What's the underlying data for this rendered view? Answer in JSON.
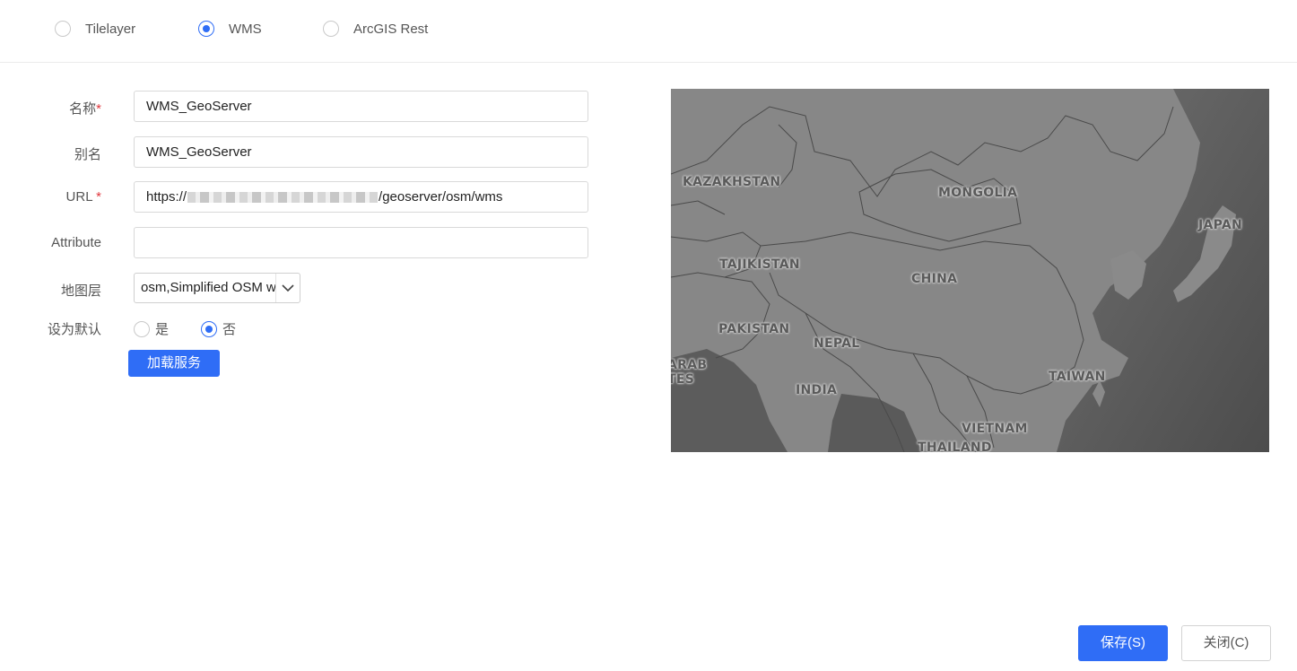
{
  "source_tabs": [
    {
      "label": "Tilelayer",
      "selected": false
    },
    {
      "label": "WMS",
      "selected": true
    },
    {
      "label": "ArcGIS Rest",
      "selected": false
    }
  ],
  "form": {
    "name": {
      "label": "名称",
      "required_mark": "*",
      "value": "WMS_GeoServer"
    },
    "alias": {
      "label": "别名",
      "value": "WMS_GeoServer"
    },
    "url": {
      "label": "URL",
      "required_mark": "*",
      "prefix": "https://",
      "suffix": "/geoserver/osm/wms"
    },
    "attribute": {
      "label": "Attribute",
      "value": ""
    },
    "layer": {
      "label": "地图层",
      "selected": "osm,Simplified OSM w"
    },
    "default": {
      "label": "设为默认",
      "options": [
        {
          "label": "是",
          "selected": false
        },
        {
          "label": "否",
          "selected": true
        }
      ]
    },
    "load_button": "加载服务"
  },
  "map": {
    "places": [
      "KAZAKHSTAN",
      "MONGOLIA",
      "JAPAN",
      "TAJIKISTAN",
      "CHINA",
      "PAKISTAN",
      "NEPAL",
      "ARAB",
      "TES",
      "INDIA",
      "TAIWAN",
      "VIETNAM",
      "THAILAND"
    ]
  },
  "footer": {
    "save": "保存(S)",
    "close": "关闭(C)"
  }
}
